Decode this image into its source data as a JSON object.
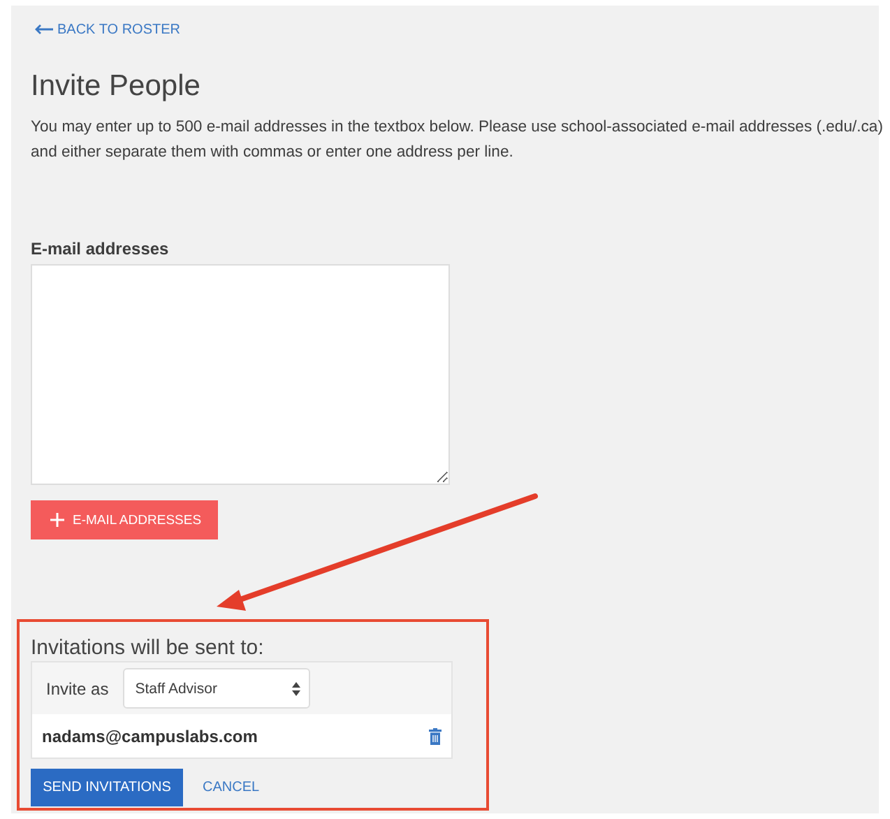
{
  "back_link": {
    "label": "BACK TO ROSTER"
  },
  "title": "Invite People",
  "instructions": "You may enter up to 500 e-mail addresses in the textbox below. Please use school-associated e-mail addresses (.edu/.ca) and either separate them with commas or enter one address per line.",
  "email_field": {
    "label": "E-mail addresses"
  },
  "add_button": {
    "label": "E-MAIL ADDRESSES"
  },
  "invitations": {
    "heading": "Invitations will be sent to:",
    "invite_as_label": "Invite as",
    "role": "Staff Advisor",
    "recipients": [
      {
        "email": "nadams@campuslabs.com"
      }
    ]
  },
  "buttons": [
    {
      "kind": "primary",
      "label": "SEND INVITATIONS"
    },
    {
      "kind": "link",
      "label": "CANCEL"
    }
  ]
}
